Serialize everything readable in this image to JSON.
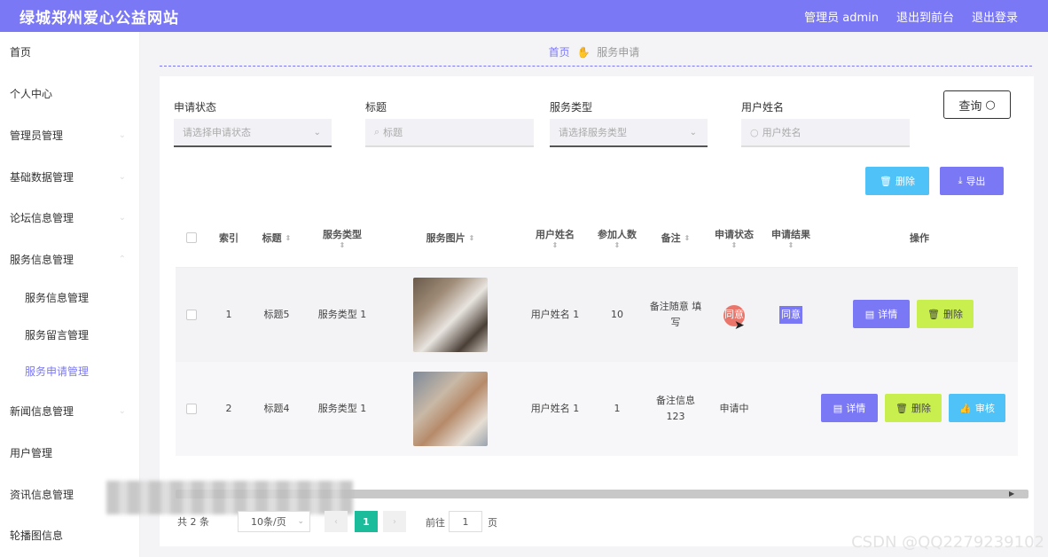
{
  "header": {
    "brand": "绿城郑州爱心公益网站",
    "admin_label": "管理员 admin",
    "to_front": "退出到前台",
    "logout": "退出登录"
  },
  "sidebar": {
    "items": [
      {
        "label": "首页"
      },
      {
        "label": "个人中心"
      },
      {
        "label": "管理员管理"
      },
      {
        "label": "基础数据管理"
      },
      {
        "label": "论坛信息管理"
      },
      {
        "label": "服务信息管理"
      },
      {
        "label": "服务信息管理"
      },
      {
        "label": "服务留言管理"
      },
      {
        "label": "服务申请管理"
      },
      {
        "label": "新闻信息管理"
      },
      {
        "label": "用户管理"
      },
      {
        "label": "资讯信息管理"
      },
      {
        "label": "轮播图信息"
      }
    ]
  },
  "breadcrumb": {
    "home": "首页",
    "current": "服务申请"
  },
  "filters": {
    "status_label": "申请状态",
    "status_placeholder": "请选择申请状态",
    "title_label": "标题",
    "title_placeholder": "标题",
    "type_label": "服务类型",
    "type_placeholder": "请选择服务类型",
    "user_label": "用户姓名",
    "user_placeholder": "用户姓名",
    "query_label": "查询"
  },
  "toolbar": {
    "delete_label": "删除",
    "export_label": "导出"
  },
  "table": {
    "headers": {
      "index": "索引",
      "title": "标题",
      "service_type": "服务类型",
      "service_image": "服务图片",
      "user_name": "用户姓名",
      "participants": "参加人数",
      "remark": "备注",
      "status": "申请状态",
      "result": "申请结果",
      "actions": "操作"
    },
    "rows": [
      {
        "index": "1",
        "title": "标题5",
        "service_type": "服务类型 1",
        "user_name": "用户姓名 1",
        "participants": "10",
        "remark": "备注随意 填写",
        "status": "同意",
        "result": "同意",
        "detail": "详情",
        "delete": "删除"
      },
      {
        "index": "2",
        "title": "标题4",
        "service_type": "服务类型 1",
        "user_name": "用户姓名 1",
        "participants": "1",
        "remark": "备注信息 123",
        "status": "申请中",
        "result": "",
        "detail": "详情",
        "delete": "删除",
        "audit": "审核"
      }
    ]
  },
  "pagination": {
    "total": "共 2 条",
    "page_size": "10条/页",
    "current_page": "1",
    "goto_label": "前往",
    "goto_value": "1",
    "page_suffix": "页"
  },
  "watermark": "CSDN @QQ2279239102"
}
